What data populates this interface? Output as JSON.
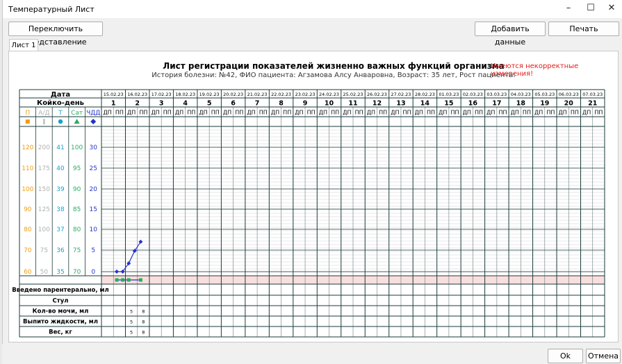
{
  "window": {
    "title": "Температурный Лист",
    "minimize_icon": "–",
    "maximize_icon": "☐",
    "close_icon": "✕"
  },
  "toolbar": {
    "switch_view": "Переключить представление",
    "add_data": "Добавить данные",
    "print": "Печать"
  },
  "tabs": [
    {
      "label": "Лист 1"
    }
  ],
  "sheet": {
    "title": "Лист регистрации показателей жизненно важных функций организма",
    "subtitle": "История болезни: №42, ФИО пациента: Агзамова Алсу Анваровна, Возраст: 35 лет, Рост пациента:",
    "warning": "Имеются некорректные измерения!"
  },
  "table": {
    "date_label": "Дата",
    "bedday_label": "Койко-день",
    "shift_labels": [
      "ДП",
      "ПП"
    ],
    "dates": [
      "15.02.23",
      "16.02.23",
      "17.02.23",
      "18.02.23",
      "19.02.23",
      "20.02.23",
      "21.02.23",
      "22.02.23",
      "23.02.23",
      "24.02.23",
      "25.02.23",
      "26.02.23",
      "27.02.23",
      "28.02.23",
      "01.03.23",
      "02.03.23",
      "03.03.23",
      "04.03.23",
      "05.03.23",
      "06.03.23",
      "07.03.23"
    ],
    "beddays": [
      "1",
      "2",
      "3",
      "4",
      "5",
      "6",
      "7",
      "8",
      "9",
      "10",
      "11",
      "12",
      "13",
      "14",
      "15",
      "16",
      "17",
      "18",
      "19",
      "20",
      "21"
    ],
    "param_headers": [
      {
        "label": "П",
        "color": "#f39c12",
        "icon": "square"
      },
      {
        "label": "А/Д",
        "color": "#b0b0b0",
        "icon": "bar"
      },
      {
        "label": "Т",
        "color": "#17a2c7",
        "icon": "circle"
      },
      {
        "label": "Сат",
        "color": "#27ae60",
        "icon": "triangle"
      },
      {
        "label": "ЧДД",
        "color": "#2233cc",
        "icon": "diamond"
      }
    ],
    "scale_rows": [
      [
        "120",
        "200",
        "41",
        "100",
        "30"
      ],
      [
        "110",
        "175",
        "40",
        "95",
        "25"
      ],
      [
        "100",
        "150",
        "39",
        "90",
        "20"
      ],
      [
        "90",
        "125",
        "38",
        "85",
        "15"
      ],
      [
        "80",
        "100",
        "37",
        "80",
        "10"
      ],
      [
        "70",
        "75",
        "36",
        "75",
        "5"
      ],
      [
        "60",
        "50",
        "35",
        "70",
        "0"
      ]
    ],
    "bottom_rows": [
      {
        "label": "Введено парентерально, мл",
        "values": []
      },
      {
        "label": "Стул",
        "values": []
      },
      {
        "label": "Кол-во мочи, мл",
        "values": [
          {
            "col": 2,
            "text": "5"
          },
          {
            "col": 3,
            "text": "8"
          }
        ]
      },
      {
        "label": "Выпито жидкости, мл",
        "values": [
          {
            "col": 2,
            "text": "5"
          },
          {
            "col": 3,
            "text": "8"
          }
        ]
      },
      {
        "label": "Вес, кг",
        "values": [
          {
            "col": 2,
            "text": "5"
          },
          {
            "col": 3,
            "text": "8"
          }
        ]
      }
    ]
  },
  "chart_data": {
    "type": "line",
    "series": [
      {
        "name": "ЧДД",
        "color": "#2233cc",
        "marker": "diamond",
        "points": [
          {
            "col": 0,
            "value": 0
          },
          {
            "col": 1,
            "value": 0
          },
          {
            "col": 2,
            "value": 2
          },
          {
            "col": 3,
            "value": 5
          },
          {
            "col": 4,
            "value": 7.2
          }
        ]
      }
    ],
    "saturation_markers": [
      {
        "col": 0,
        "color": "#27ae60"
      },
      {
        "col": 1,
        "color": "#27ae60"
      },
      {
        "col": 2,
        "color": "#27ae60"
      },
      {
        "col": 3,
        "color": "#27ae60"
      },
      {
        "col": 4,
        "color": "#27ae60"
      }
    ],
    "ylim_chdd": [
      0,
      30
    ]
  },
  "footer": {
    "ok": "Ok",
    "cancel": "Отмена"
  }
}
